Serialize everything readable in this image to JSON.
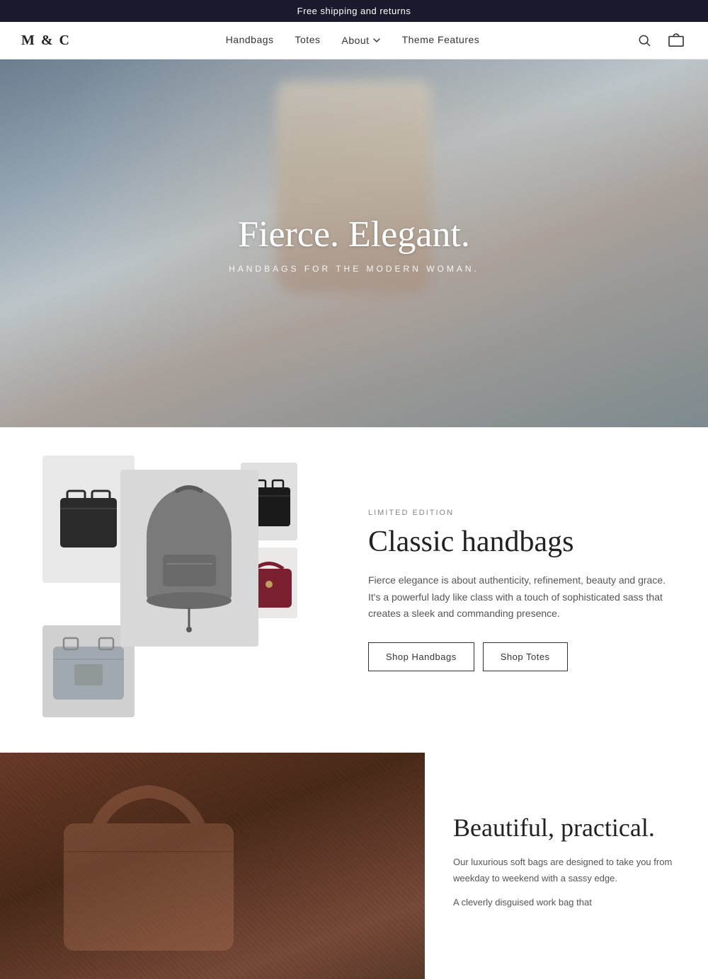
{
  "announcement": {
    "text": "Free shipping and returns"
  },
  "header": {
    "logo": "M & C",
    "nav": [
      {
        "label": "Handbags",
        "id": "handbags"
      },
      {
        "label": "Totes",
        "id": "totes"
      },
      {
        "label": "About",
        "id": "about",
        "hasDropdown": true
      },
      {
        "label": "Theme Features",
        "id": "theme-features"
      }
    ],
    "search_label": "Search",
    "cart_label": "Cart"
  },
  "hero": {
    "title": "Fierce. Elegant.",
    "subtitle": "HANDBAGS FOR THE MODERN WOMAN."
  },
  "feature": {
    "limited_label": "LIMITED EDITION",
    "heading": "Classic handbags",
    "description": "Fierce elegance is about authenticity, refinement, beauty and grace. It's a powerful lady like class with a touch of sophisticated sass that creates a sleek and commanding presence.",
    "btn_handbags": "Shop Handbags",
    "btn_totes": "Shop Totes"
  },
  "second": {
    "heading": "Beautiful, practical.",
    "text1": "Our luxurious soft bags are designed to take you from weekday to weekend with a sassy edge.",
    "text2": "A cleverly disguised work bag that"
  }
}
